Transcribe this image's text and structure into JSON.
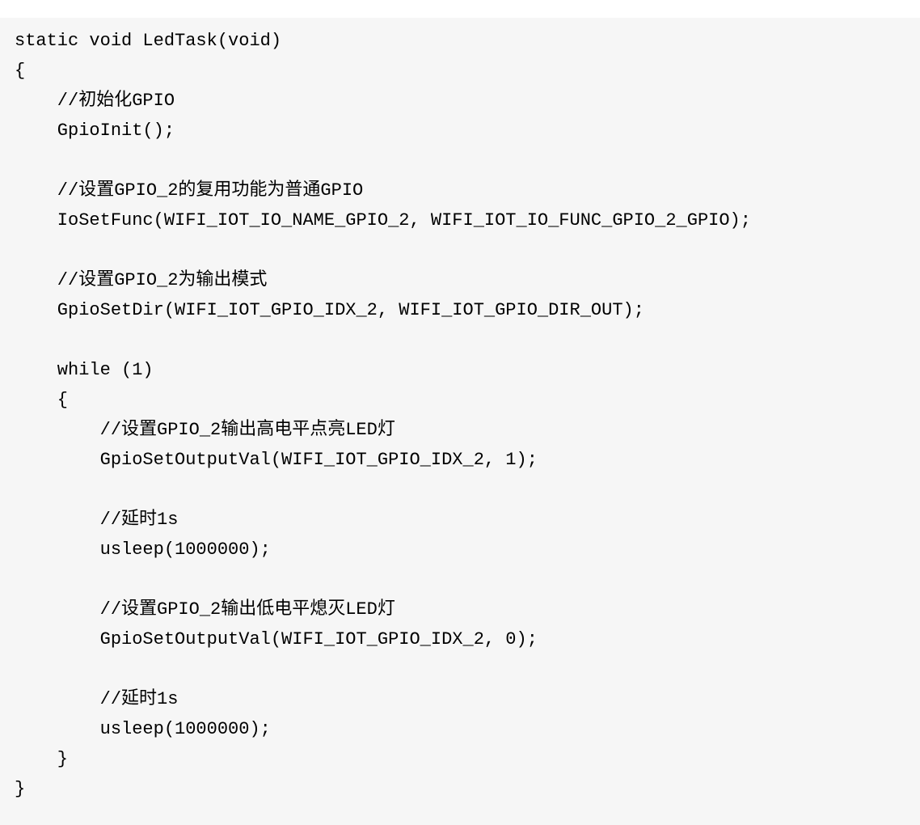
{
  "code": {
    "lines": [
      "static void LedTask(void)",
      "{",
      "    //初始化GPIO",
      "    GpioInit();",
      "",
      "    //设置GPIO_2的复用功能为普通GPIO",
      "    IoSetFunc(WIFI_IOT_IO_NAME_GPIO_2, WIFI_IOT_IO_FUNC_GPIO_2_GPIO);",
      "",
      "    //设置GPIO_2为输出模式",
      "    GpioSetDir(WIFI_IOT_GPIO_IDX_2, WIFI_IOT_GPIO_DIR_OUT);",
      "",
      "    while (1)",
      "    {",
      "        //设置GPIO_2输出高电平点亮LED灯",
      "        GpioSetOutputVal(WIFI_IOT_GPIO_IDX_2, 1);",
      "",
      "        //延时1s",
      "        usleep(1000000);",
      "",
      "        //设置GPIO_2输出低电平熄灭LED灯",
      "        GpioSetOutputVal(WIFI_IOT_GPIO_IDX_2, 0);",
      "",
      "        //延时1s",
      "        usleep(1000000);",
      "    }",
      "}"
    ]
  }
}
